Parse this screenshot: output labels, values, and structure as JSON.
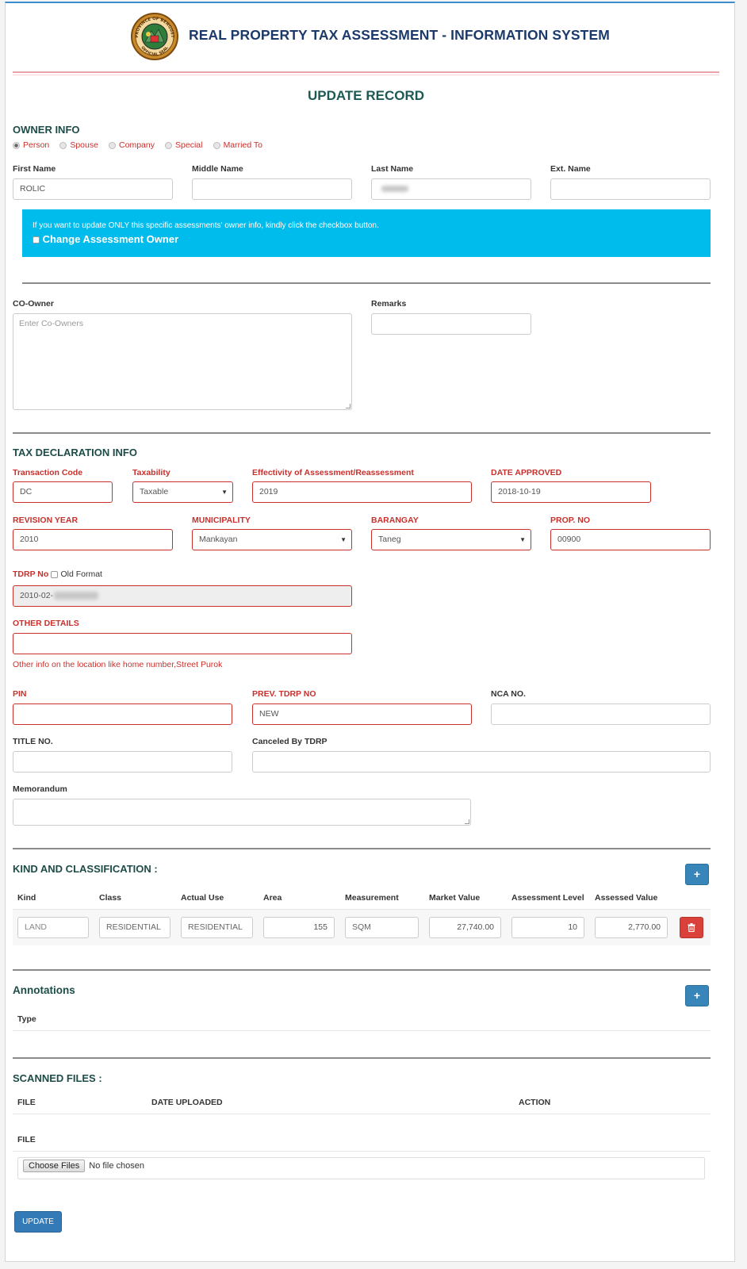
{
  "header": {
    "title": "REAL PROPERTY TAX ASSESSMENT - INFORMATION SYSTEM",
    "logo_top_text": "PROVINCE OF BENGUET",
    "logo_bottom_text": "OFFICIAL SEAL"
  },
  "page_title": "UPDATE RECORD",
  "owner_info": {
    "title": "OWNER INFO",
    "types": [
      "Person",
      "Spouse",
      "Company",
      "Special",
      "Married To"
    ],
    "selected_type": "Person",
    "first_name_label": "First Name",
    "first_name_value": "ROLIC",
    "middle_name_label": "Middle Name",
    "middle_name_value": "",
    "last_name_label": "Last Name",
    "ext_name_label": "Ext. Name",
    "ext_name_value": "",
    "info_text": "If you want to update ONLY this specific assessments' owner info, kindly click the checkbox button.",
    "change_owner_label": "Change Assessment Owner"
  },
  "co_owner": {
    "label": "CO-Owner",
    "placeholder": "Enter Co-Owners",
    "remarks_label": "Remarks",
    "remarks_value": ""
  },
  "tax_declaration": {
    "title": "TAX DECLARATION INFO",
    "transaction_code_label": "Transaction Code",
    "transaction_code_value": "DC",
    "taxability_label": "Taxability",
    "taxability_value": "Taxable",
    "effectivity_label": "Effectivity of Assessment/Reassessment",
    "effectivity_value": "2019",
    "date_approved_label": "DATE APPROVED",
    "date_approved_value": "2018-10-19",
    "revision_year_label": "REVISION YEAR",
    "revision_year_value": "2010",
    "municipality_label": "MUNICIPALITY",
    "municipality_value": "Mankayan",
    "barangay_label": "BARANGAY",
    "barangay_value": "Taneg",
    "prop_no_label": "PROP. NO",
    "prop_no_value": "00900",
    "tdrp_label": "TDRP No",
    "old_format_label": "Old Format",
    "tdrp_value": "2010-02-",
    "other_details_label": "OTHER DETAILS",
    "other_details_value": "",
    "other_details_help": "Other info on the location like home number,Street Purok",
    "pin_label": "PIN",
    "pin_value": "",
    "prev_tdrp_label": "PREV. TDRP NO",
    "prev_tdrp_value": "NEW",
    "nca_label": "NCA NO.",
    "nca_value": "",
    "title_no_label": "TITLE NO.",
    "title_no_value": "",
    "canceled_by_label": "Canceled By TDRP",
    "canceled_by_value": "",
    "memorandum_label": "Memorandum",
    "memorandum_value": ""
  },
  "kind_classification": {
    "title": "KIND AND CLASSIFICATION :",
    "add_label": "+",
    "headers": [
      "Kind",
      "Class",
      "Actual Use",
      "Area",
      "Measurement",
      "Market Value",
      "Assessment Level",
      "Assessed Value"
    ],
    "row": {
      "kind": "LAND",
      "class": "RESIDENTIAL",
      "actual_use": "RESIDENTIAL",
      "area": "155",
      "measurement": "SQM",
      "market_value": "27,740.00",
      "assessment_level": "10",
      "assessed_value": "2,770.00"
    }
  },
  "annotations": {
    "title": "Annotations",
    "add_label": "+",
    "type_header": "Type"
  },
  "scanned_files": {
    "title": "SCANNED FILES :",
    "headers": {
      "file": "FILE",
      "date": "DATE UPLOADED",
      "action": "ACTION"
    },
    "file_label": "FILE",
    "choose_label": "Choose Files",
    "no_file_text": "No file chosen"
  },
  "update_button": "UPDATE",
  "colors": {
    "header_blue": "#1b3a6b",
    "section_green": "#1d4c48",
    "required_red": "#c9302c",
    "info_cyan": "#00bcec",
    "primary_blue": "#337ab7",
    "danger_red": "#d9413a"
  }
}
